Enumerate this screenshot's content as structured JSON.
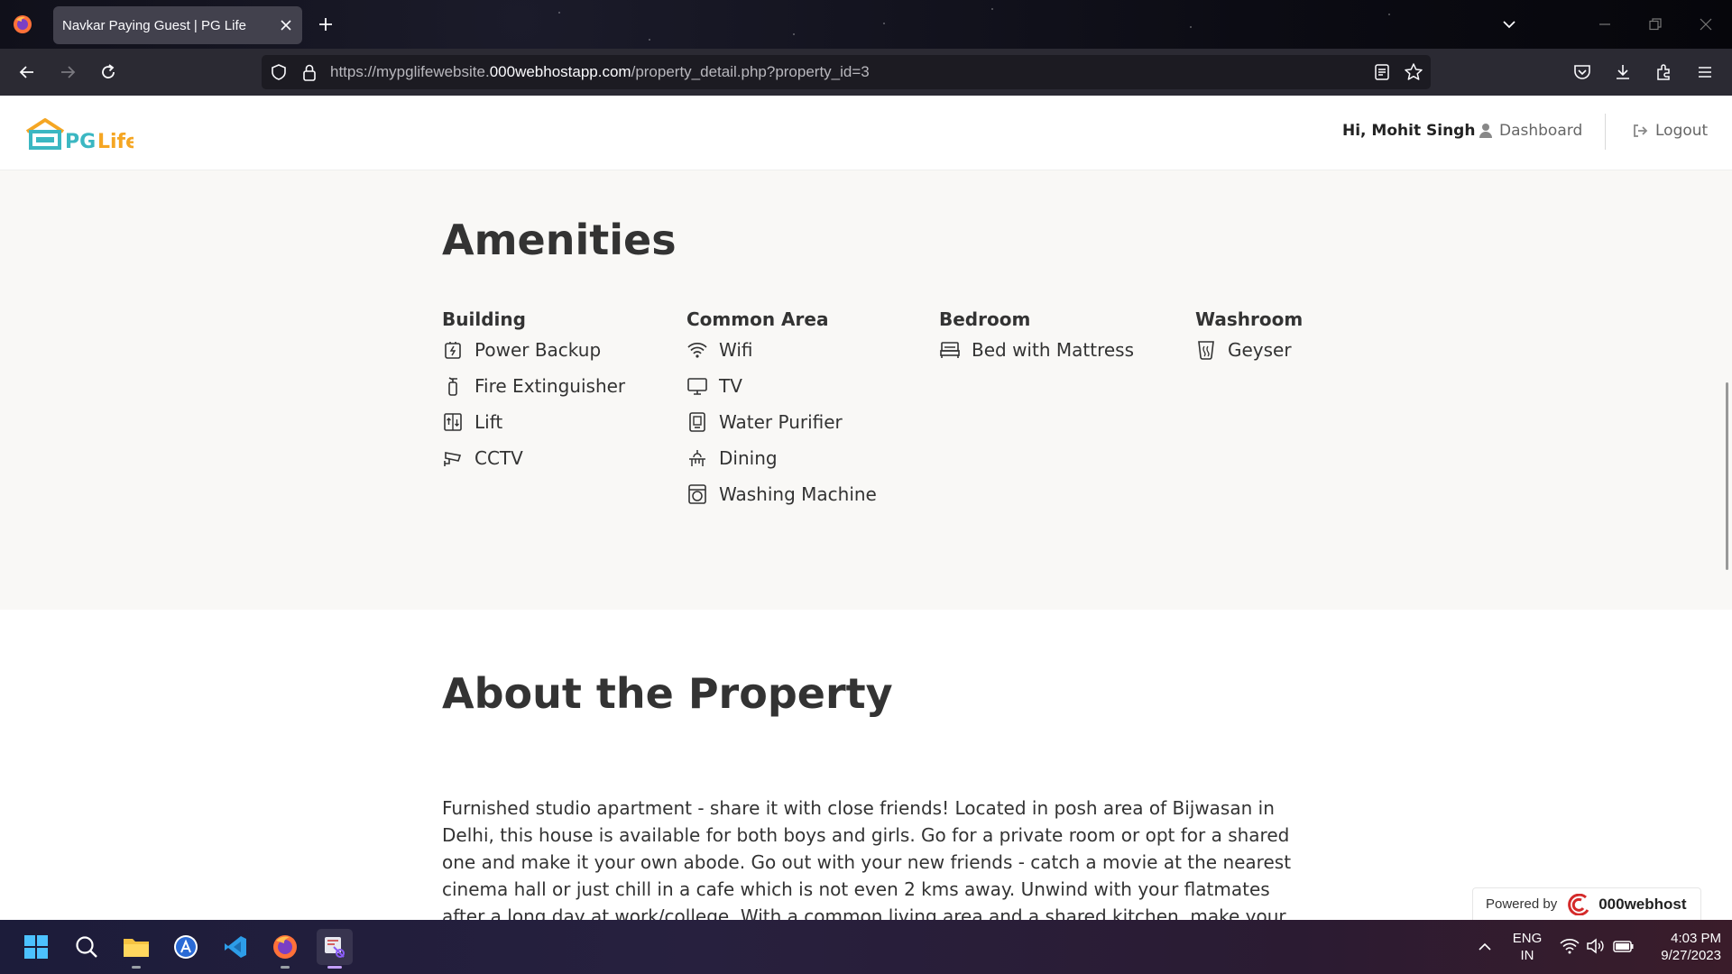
{
  "browser": {
    "tab_title": "Navkar Paying Guest | PG Life",
    "url_prefix": "https://mypglifewebsite.",
    "url_domain": "000webhostapp.com",
    "url_path": "/property_detail.php?property_id=3"
  },
  "header": {
    "logo_text": "PG Life",
    "greeting": "Hi, Mohit Singh",
    "dashboard_label": "Dashboard",
    "logout_label": "Logout"
  },
  "amenities": {
    "title": "Amenities",
    "columns": [
      {
        "heading": "Building",
        "items": [
          {
            "label": "Power Backup",
            "icon": "power-backup-icon"
          },
          {
            "label": "Fire Extinguisher",
            "icon": "fire-extinguisher-icon"
          },
          {
            "label": "Lift",
            "icon": "lift-icon"
          },
          {
            "label": "CCTV",
            "icon": "cctv-icon"
          }
        ]
      },
      {
        "heading": "Common Area",
        "items": [
          {
            "label": "Wifi",
            "icon": "wifi-icon"
          },
          {
            "label": "TV",
            "icon": "tv-icon"
          },
          {
            "label": "Water Purifier",
            "icon": "water-purifier-icon"
          },
          {
            "label": "Dining",
            "icon": "dining-icon"
          },
          {
            "label": "Washing Machine",
            "icon": "washing-machine-icon"
          }
        ]
      },
      {
        "heading": "Bedroom",
        "items": [
          {
            "label": "Bed with Mattress",
            "icon": "bed-icon"
          }
        ]
      },
      {
        "heading": "Washroom",
        "items": [
          {
            "label": "Geyser",
            "icon": "geyser-icon"
          }
        ]
      }
    ]
  },
  "about": {
    "title": "About the Property",
    "text": "Furnished studio apartment - share it with close friends! Located in posh area of Bijwasan in Delhi, this house is available for both boys and girls. Go for a private room or opt for a shared one and make it your own abode. Go out with your new friends - catch a movie at the nearest cinema hall or just chill in a cafe which is not even 2 kms away. Unwind with your flatmates after a long day at work/college. With a common living area and a shared kitchen, make your own FRIENDS moments."
  },
  "powered_by": {
    "label": "Powered by",
    "brand": "000webhost"
  },
  "taskbar": {
    "lang_top": "ENG",
    "lang_bottom": "IN",
    "time": "4:03 PM",
    "date": "9/27/2023"
  },
  "colors": {
    "logo_teal": "#3bb7c2",
    "logo_orange": "#f5a623",
    "amenities_bg": "#f9f8f6",
    "text": "#333333"
  }
}
